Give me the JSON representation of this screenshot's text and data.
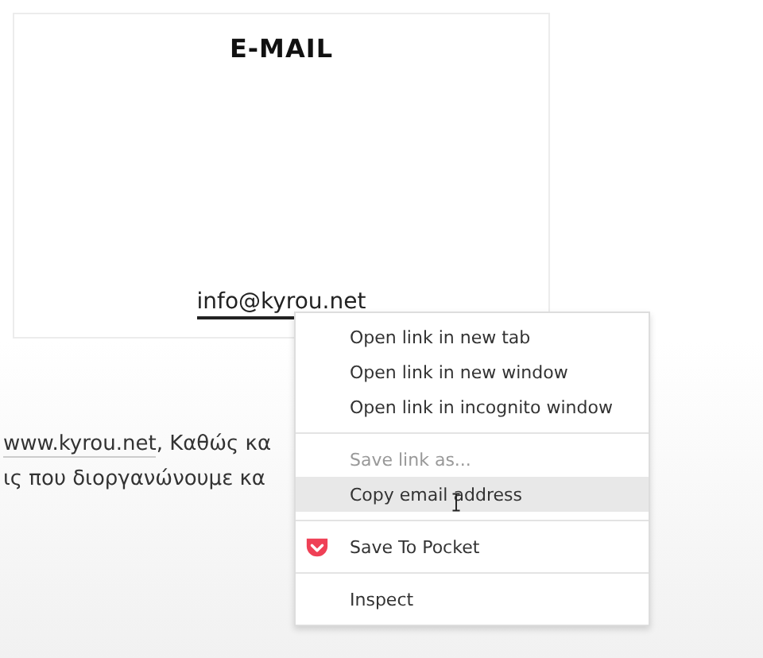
{
  "card": {
    "title": "E-MAIL",
    "email": "info@kyrou.net"
  },
  "paragraph": {
    "link": "www.kyrou.net",
    "line_1_rest": ", Καθώς κα",
    "line_2": "ις που διοργανώνουμε κα"
  },
  "context_menu": {
    "items": [
      {
        "kind": "item",
        "label": "Open link in new tab",
        "disabled": false,
        "selected": false
      },
      {
        "kind": "item",
        "label": "Open link in new window",
        "disabled": false,
        "selected": false
      },
      {
        "kind": "item",
        "label": "Open link in incognito window",
        "disabled": false,
        "selected": false
      },
      {
        "kind": "divider"
      },
      {
        "kind": "item",
        "label": "Save link as...",
        "disabled": true,
        "selected": false
      },
      {
        "kind": "item",
        "label": "Copy email address",
        "disabled": false,
        "selected": true
      },
      {
        "kind": "divider"
      },
      {
        "kind": "pocket",
        "label": "Save To Pocket",
        "disabled": false,
        "selected": false
      },
      {
        "kind": "divider"
      },
      {
        "kind": "item",
        "label": "Inspect",
        "disabled": false,
        "selected": false
      }
    ]
  }
}
